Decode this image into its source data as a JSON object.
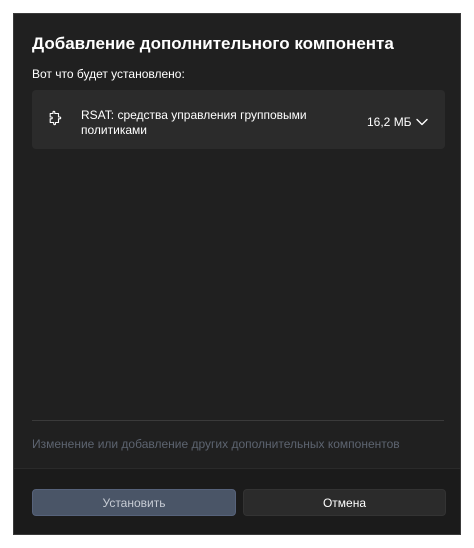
{
  "dialog": {
    "title": "Добавление дополнительного компонента",
    "subtitle": "Вот что будет установлено:"
  },
  "component": {
    "icon": "puzzle-piece-icon",
    "name": "RSAT: средства управления групповыми политиками",
    "size": "16,2 МБ",
    "expand_icon": "chevron-down-icon"
  },
  "links": {
    "more_components": "Изменение или добавление других дополнительных компонентов"
  },
  "buttons": {
    "install": "Установить",
    "cancel": "Отмена"
  },
  "colors": {
    "dialog_bg": "#202020",
    "card_bg": "#2b2b2b",
    "footer_bg": "#1b1b1b",
    "link_disabled": "#5d6470",
    "primary_button": "#4a5567"
  }
}
